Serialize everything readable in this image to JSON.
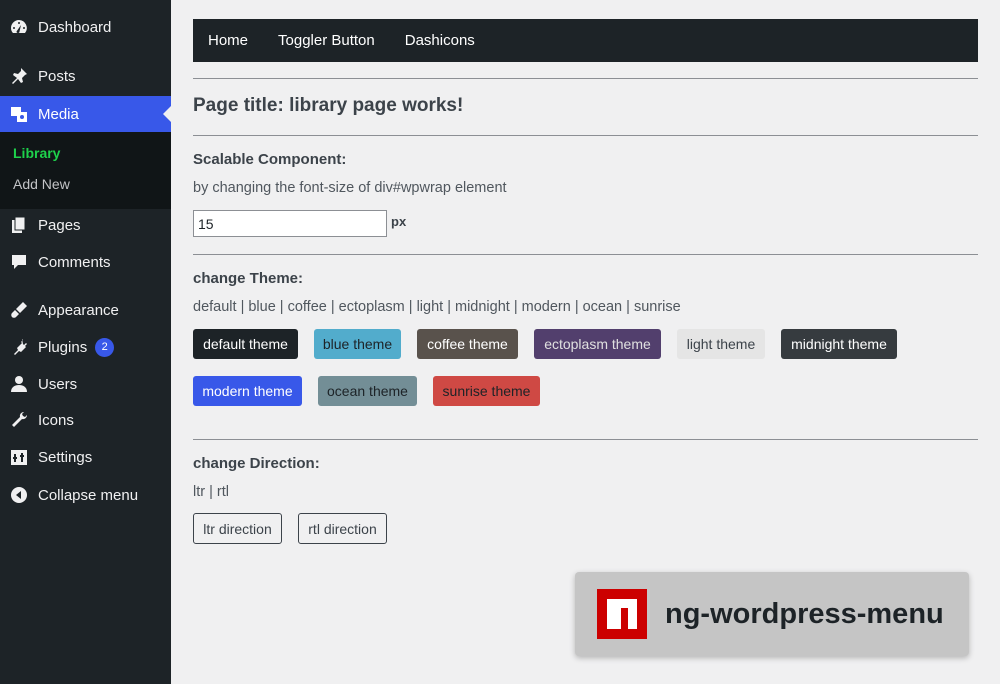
{
  "sidebar": {
    "items": [
      {
        "label": "Dashboard",
        "icon": "dashboard-icon"
      },
      {
        "label": "Posts",
        "icon": "pin-icon"
      },
      {
        "label": "Media",
        "icon": "media-icon"
      },
      {
        "label": "Pages",
        "icon": "pages-icon"
      },
      {
        "label": "Comments",
        "icon": "comment-icon"
      },
      {
        "label": "Appearance",
        "icon": "brush-icon"
      },
      {
        "label": "Plugins",
        "icon": "plug-icon",
        "badge": "2"
      },
      {
        "label": "Users",
        "icon": "user-icon"
      },
      {
        "label": "Icons",
        "icon": "wrench-icon"
      },
      {
        "label": "Settings",
        "icon": "settings-icon"
      },
      {
        "label": "Collapse menu",
        "icon": "collapse-icon"
      }
    ],
    "submenu": [
      {
        "label": "Library"
      },
      {
        "label": "Add New"
      }
    ]
  },
  "navbar": {
    "links": [
      "Home",
      "Toggler Button",
      "Dashicons"
    ]
  },
  "main": {
    "title": "Page title: library page works!",
    "scalable": {
      "heading": "Scalable Component:",
      "description": "by changing the font-size of div#wpwrap element",
      "value": "15",
      "unit": "px"
    },
    "theme": {
      "heading": "change Theme:",
      "options_text": "default | blue | coffee | ectoplasm | light | midnight | modern | ocean | sunrise",
      "buttons": [
        {
          "label": "default theme",
          "bg": "#1d2327",
          "fg": "#ffffff"
        },
        {
          "label": "blue theme",
          "bg": "#52accc",
          "fg": "#1d2327"
        },
        {
          "label": "coffee theme",
          "bg": "#59524c",
          "fg": "#ffffff"
        },
        {
          "label": "ectoplasm theme",
          "bg": "#523f6d",
          "fg": "#e0e0e0"
        },
        {
          "label": "light theme",
          "bg": "#e5e5e5",
          "fg": "#3c434a"
        },
        {
          "label": "midnight theme",
          "bg": "#363b3f",
          "fg": "#ffffff"
        },
        {
          "label": "modern theme",
          "bg": "#3858e9",
          "fg": "#ffffff"
        },
        {
          "label": "ocean theme",
          "bg": "#738e96",
          "fg": "#1d2327"
        },
        {
          "label": "sunrise theme",
          "bg": "#cf4944",
          "fg": "#1d2327"
        }
      ]
    },
    "direction": {
      "heading": "change Direction:",
      "options_text": "ltr | rtl",
      "buttons": [
        "ltr direction",
        "rtl direction"
      ]
    }
  },
  "badge": {
    "text": "ng-wordpress-menu",
    "logo": "npm-logo"
  }
}
